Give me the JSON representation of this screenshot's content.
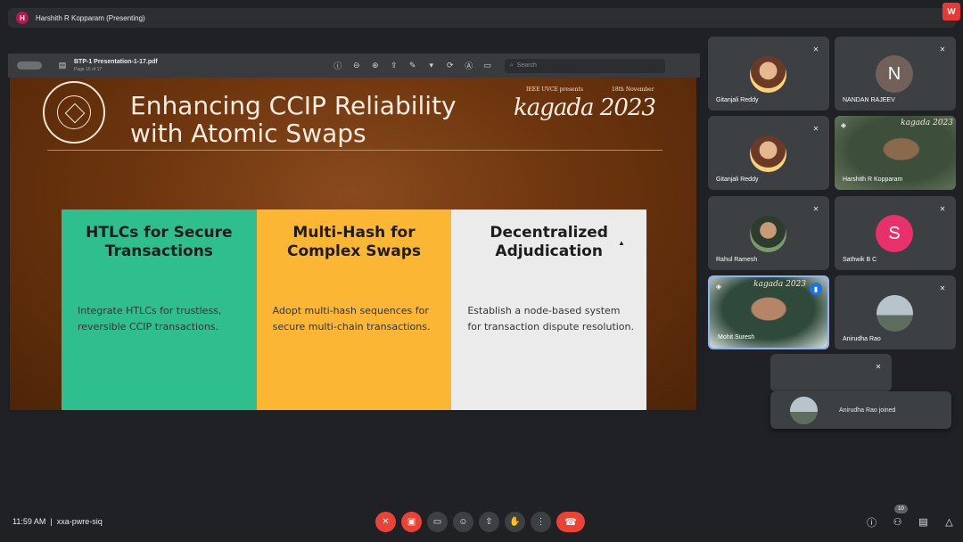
{
  "topbar": {
    "avatar_letter": "H",
    "presenting_text": "Harshith R Kopparam (Presenting)",
    "brand_logo": "W"
  },
  "pdf": {
    "file_name": "BTP-1 Presentation-1-17.pdf",
    "page_info": "Page 16 of 17",
    "search_placeholder": "Search"
  },
  "slide": {
    "title": "Enhancing CCIP Reliability with Atomic Swaps",
    "event_presenter": "IEEE UVCE presents",
    "event_date": "18th November",
    "event_name": "kagada 2023",
    "cards": [
      {
        "heading": "HTLCs for Secure Transactions",
        "body": "Integrate HTLCs for trustless, reversible CCIP transactions."
      },
      {
        "heading": "Multi-Hash for Complex Swaps",
        "body": "Adopt multi-hash sequences for secure multi-chain transactions."
      },
      {
        "heading": "Decentralized Adjudication",
        "body": "Establish a node-based system for transaction dispute resolution."
      }
    ]
  },
  "participants": [
    {
      "name": "Gitanjali Reddy"
    },
    {
      "name": "NANDAN RAJEEV",
      "letter": "N"
    },
    {
      "name": "Gitanjali Reddy"
    },
    {
      "name": "Harshith R Kopparam",
      "overlay": "kagada 2023"
    },
    {
      "name": "Rahul Ramesh"
    },
    {
      "name": "Sathwik B C",
      "letter": "S"
    },
    {
      "name": "Mohit Suresh",
      "overlay": "kagada 2023"
    },
    {
      "name": "Anirudha Rao"
    }
  ],
  "toast": {
    "message": "Anirudha Rao joined"
  },
  "bottom": {
    "time": "11:59 AM",
    "separator": "|",
    "meeting_code": "xxa-pwre-siq",
    "people_count": "10"
  },
  "colors": {
    "card1": "#2fbf8f",
    "card2": "#fbb734",
    "card3": "#ebebeb",
    "danger": "#ea4335",
    "active_border": "#8ab4f8"
  }
}
